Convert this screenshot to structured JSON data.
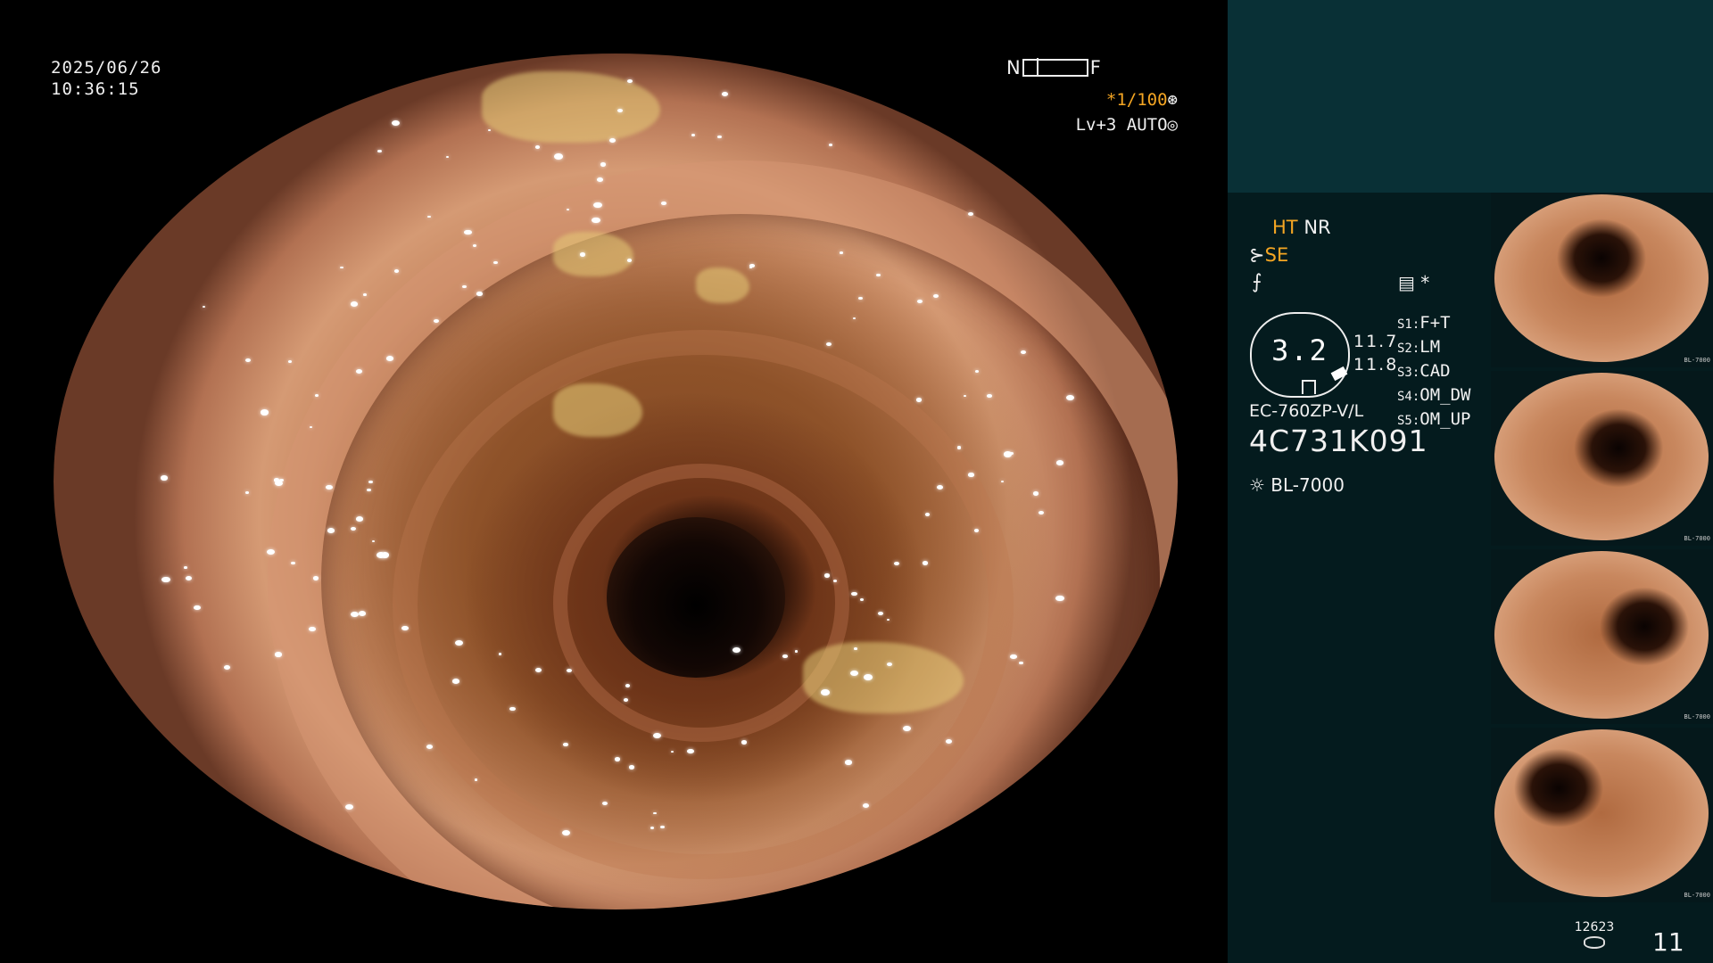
{
  "osd": {
    "date": "2025/06/26",
    "time": "10:36:15",
    "near_label": "N",
    "far_label": "F",
    "shutter": "*1/100",
    "level": "Lv+3 AUTO"
  },
  "panel": {
    "ht": "HT",
    "nr": "NR",
    "se": "SE",
    "asterisk": "*",
    "gauge_value": "3.2",
    "g_top": "11.7",
    "g_bottom": "11.8",
    "settings": [
      {
        "key": "S1:",
        "value": "F+T"
      },
      {
        "key": "S2:",
        "value": "LM"
      },
      {
        "key": "S3:",
        "value": "CAD"
      },
      {
        "key": "S4:",
        "value": "OM_DW"
      },
      {
        "key": "S5:",
        "value": "OM_UP"
      }
    ],
    "scope_model": "EC-760ZP-V/L",
    "scope_serial": "4C731K091",
    "light_source": "BL-7000",
    "storage_count": "12623",
    "image_count": "11"
  },
  "thumbnails": [
    {
      "caption": "BL-7000"
    },
    {
      "caption": "BL-7000"
    },
    {
      "caption": "BL-7000"
    },
    {
      "caption": "BL-7000"
    }
  ],
  "colors": {
    "accent_orange": "#f5a623",
    "panel_top": "#093036",
    "panel_bg": "#041b1e"
  }
}
